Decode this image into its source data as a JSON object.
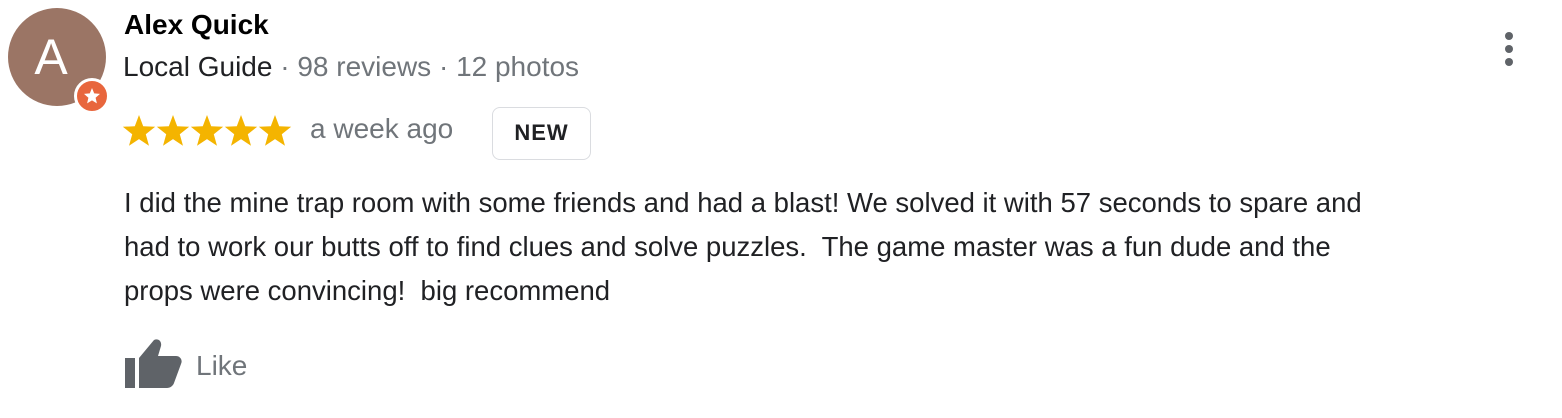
{
  "review": {
    "author": {
      "name": "Alex Quick",
      "avatar_letter": "A",
      "avatar_color": "#9b7565",
      "badge_icon": "local-guide-star-icon",
      "badge_color": "#e8663d",
      "guide_label": "Local Guide",
      "separator": " · ",
      "reviews_count": "98 reviews",
      "photos_count": "12 photos"
    },
    "rating": 5,
    "rating_max": 5,
    "star_color": "#f4b400",
    "time_ago": "a week ago",
    "new_badge": "NEW",
    "text": "I did the mine trap room with some friends and had a blast! We solved it with 57 seconds to spare and\nhad to work our butts off to find clues and solve puzzles.  The game master was a fun dude and the\nprops were convincing!  big recommend",
    "like_label": "Like",
    "like_icon": "thumbs-up-icon",
    "more_icon": "more-vert-icon"
  }
}
